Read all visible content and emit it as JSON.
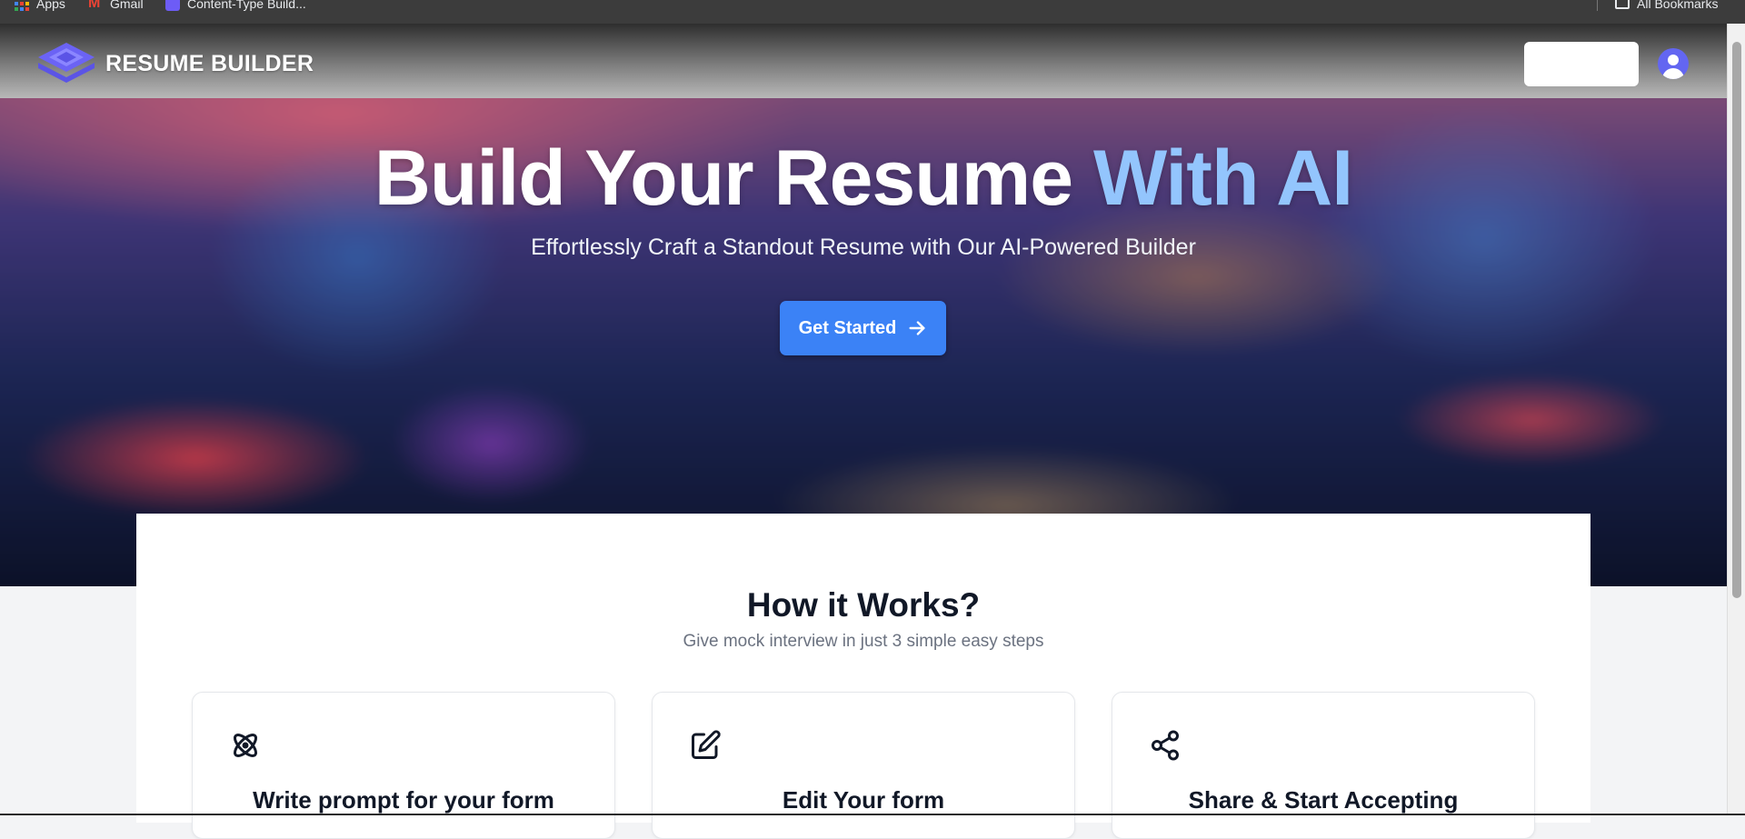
{
  "bookmarks": {
    "items": [
      {
        "label": "Apps",
        "icon": "apps-grid-icon"
      },
      {
        "label": "Gmail",
        "icon": "gmail-icon"
      },
      {
        "label": "Content-Type Build...",
        "icon": "content-type-icon"
      }
    ],
    "all_bookmarks_label": "All Bookmarks"
  },
  "navbar": {
    "brand": "RESUME BUILDER",
    "brand_icon": "layers-logo-icon",
    "avatar_icon": "user-avatar-icon"
  },
  "hero": {
    "title_main": "Build Your Resume",
    "title_accent": "With AI",
    "subtitle": "Effortlessly Craft a Standout Resume with Our AI-Powered Builder",
    "cta_label": "Get Started",
    "cta_icon": "arrow-right-icon"
  },
  "how_it_works": {
    "title": "How it Works?",
    "subtitle": "Give mock interview in just 3 simple easy steps",
    "steps": [
      {
        "title": "Write prompt for your form",
        "icon": "atom-icon"
      },
      {
        "title": "Edit Your form",
        "icon": "edit-icon"
      },
      {
        "title": "Share & Start Accepting",
        "icon": "share-icon"
      }
    ]
  },
  "colors": {
    "primary": "#3b82f6",
    "accent_text": "#93c5fd",
    "brand_purple": "#6366f1",
    "bookmarks_bar": "#3c3c3c"
  }
}
